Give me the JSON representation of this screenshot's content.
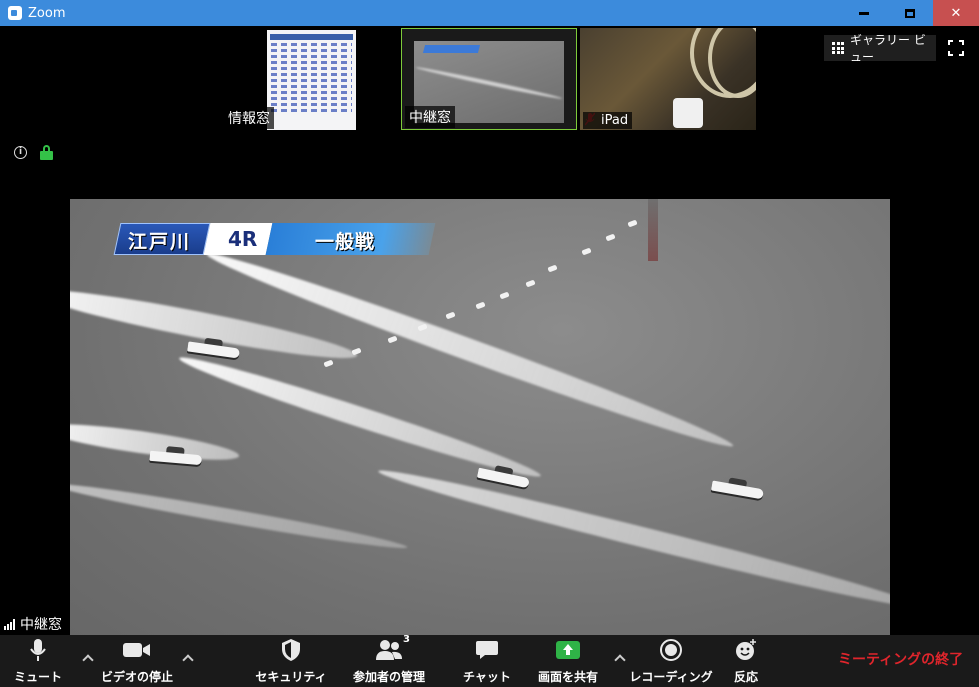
{
  "window": {
    "title": "Zoom"
  },
  "thumbnails": [
    {
      "label": "情報窓"
    },
    {
      "label": "中継窓"
    },
    {
      "label": "iPad"
    }
  ],
  "view_controls": {
    "gallery_label": "ギャラリー ビュー"
  },
  "main_video": {
    "banner": {
      "venue": "江戸川",
      "race": "4R",
      "class": "一般戦"
    },
    "participant_label": "中継窓"
  },
  "toolbar": {
    "mute": "ミュート",
    "stop_video": "ビデオの停止",
    "security": "セキュリティ",
    "participants": "参加者の管理",
    "participant_count": "3",
    "chat": "チャット",
    "share_screen": "画面を共有",
    "recording": "レコーディング",
    "reactions": "反応",
    "end_meeting": "ミーティングの終了"
  },
  "colors": {
    "titlebar": "#3c8bdc",
    "active_speaker_border": "#7ecb3a",
    "share_green": "#2fb347",
    "end_red": "#e0252c"
  }
}
